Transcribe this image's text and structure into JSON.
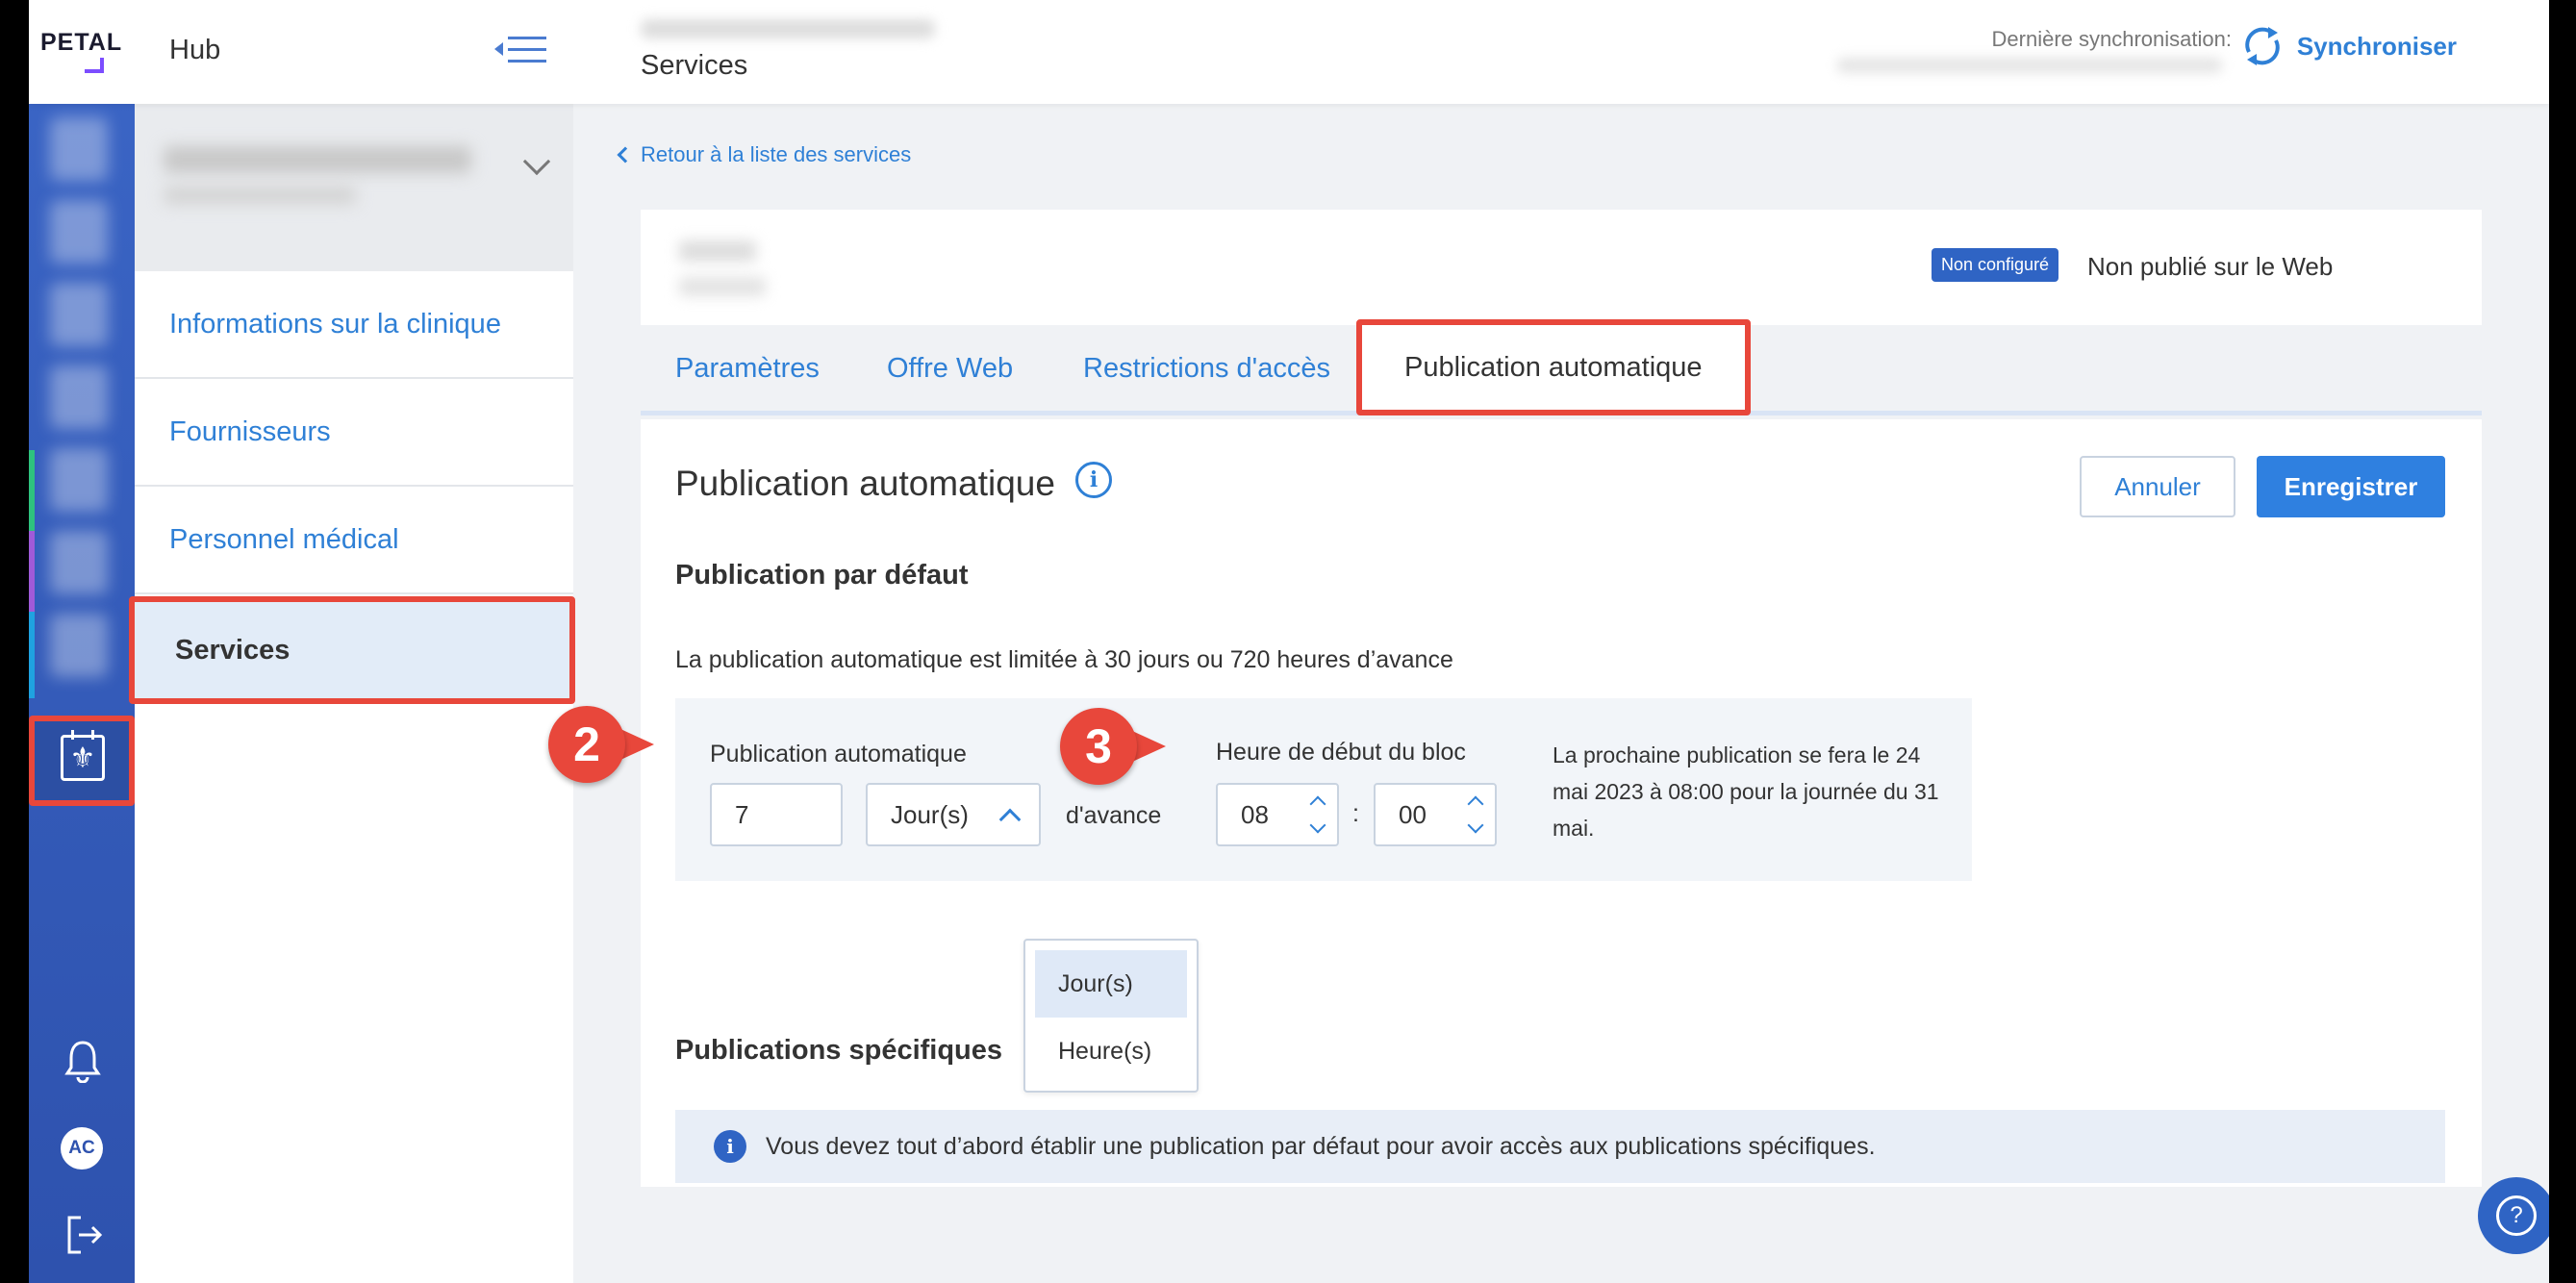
{
  "app": {
    "logo": "PETAL",
    "hub_title": "Hub",
    "page_title": "Services"
  },
  "sync": {
    "label": "Dernière synchronisation:",
    "button": "Synchroniser"
  },
  "user": {
    "initials": "AC"
  },
  "sidebar": {
    "items": [
      {
        "label": "Informations sur la clinique"
      },
      {
        "label": "Fournisseurs"
      },
      {
        "label": "Personnel médical"
      },
      {
        "label": "Services"
      }
    ]
  },
  "main": {
    "back_link": "Retour à la liste des services",
    "status_badge": "Non configuré",
    "publication_status": "Non publié sur le Web",
    "tabs": [
      {
        "label": "Paramètres"
      },
      {
        "label": "Offre Web"
      },
      {
        "label": "Restrictions d'accès"
      },
      {
        "label": "Publication automatique"
      }
    ],
    "panel_title": "Publication automatique",
    "cancel_label": "Annuler",
    "save_label": "Enregistrer",
    "default_section_title": "Publication par défaut",
    "limit_text": "La publication automatique est limitée à 30 jours ou 720 heures d’avance",
    "auto_pub_label": "Publication automatique",
    "auto_pub_value": "7",
    "unit_selected": "Jour(s)",
    "unit_options": [
      "Jour(s)",
      "Heure(s)"
    ],
    "advance_label": "d'avance",
    "start_time_label": "Heure de début du bloc",
    "start_hour": "08",
    "time_separator": ":",
    "start_minute": "00",
    "next_publication": "La prochaine publication se fera le 24 mai 2023 à 08:00 pour la journée du 31 mai.",
    "specific_section_title": "Publications spécifiques",
    "notice": "Vous devez tout d’abord établir une publication par défaut pour avoir accès aux publications spécifiques."
  },
  "callouts": [
    "2",
    "3"
  ],
  "colors": {
    "accent": "#2f80d6",
    "rail": "#3a64c4",
    "highlight": "#e8473b",
    "badge": "#2f64c4"
  }
}
